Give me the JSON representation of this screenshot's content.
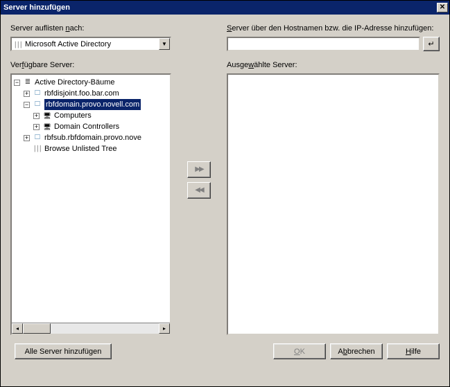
{
  "title": "Server hinzufügen",
  "labels": {
    "list_by_pre": "Server auflisten ",
    "list_by_key": "n",
    "list_by_post": "ach:",
    "hostname_pre": "",
    "hostname_key": "S",
    "hostname_post": "erver über den Hostnamen bzw. die IP-Adresse hinzufügen:",
    "available_pre": "Ver",
    "available_key": "f",
    "available_post": "ügbare Server:",
    "selected_pre": "Ausge",
    "selected_key": "w",
    "selected_post": "ählte Server:"
  },
  "dropdown": {
    "text": "Microsoft Active Directory"
  },
  "hostname_value": "",
  "tree": {
    "root": "Active Directory-Bäume",
    "n1": "rbfdisjoint.foo.bar.com",
    "n2": "rbfdomain.provo.novell.com",
    "n2a": "Computers",
    "n2b": "Domain Controllers",
    "n3": "rbfsub.rbfdomain.provo.nove",
    "n4": "Browse Unlisted Tree"
  },
  "buttons": {
    "add_all": "Alle Server hinzufügen",
    "ok_key": "O",
    "ok_post": "K",
    "cancel_pre": "A",
    "cancel_key": "b",
    "cancel_post": "brechen",
    "help_key": "H",
    "help_post": "ilfe",
    "enter": "↵"
  }
}
